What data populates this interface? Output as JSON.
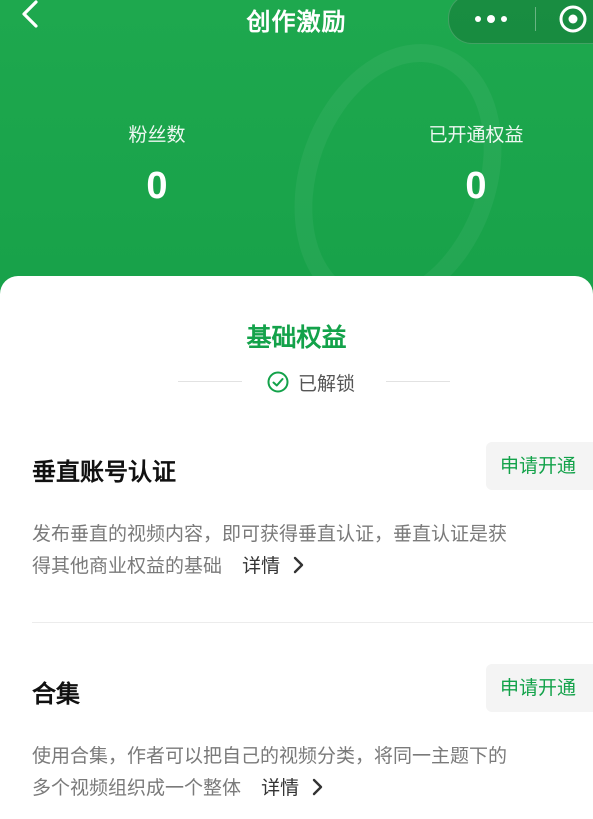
{
  "header": {
    "title": "创作激励"
  },
  "stats": [
    {
      "label": "粉丝数",
      "value": "0"
    },
    {
      "label": "已开通权益",
      "value": "0"
    }
  ],
  "section": {
    "title": "基础权益",
    "status": "已解锁"
  },
  "benefits": [
    {
      "name": "垂直账号认证",
      "button": "申请开通",
      "desc_line1": "发布垂直的视频内容，即可获得垂直认证，垂直认证是获",
      "desc_line2": "得其他商业权益的基础",
      "detail": "详情"
    },
    {
      "name": "合集",
      "button": "申请开通",
      "desc_line1": "使用合集，作者可以把自己的视频分类，将同一主题下的",
      "desc_line2": "多个视频组织成一个整体",
      "detail": "详情"
    }
  ],
  "icons": {
    "back": "chevron-left-icon",
    "more": "more-dots-icon",
    "close": "target-close-icon",
    "unlock": "check-circle-icon",
    "detail": "chevron-right-icon"
  },
  "colors": {
    "brand_green": "#1aa34a",
    "accent_text_green": "#13a24a"
  }
}
